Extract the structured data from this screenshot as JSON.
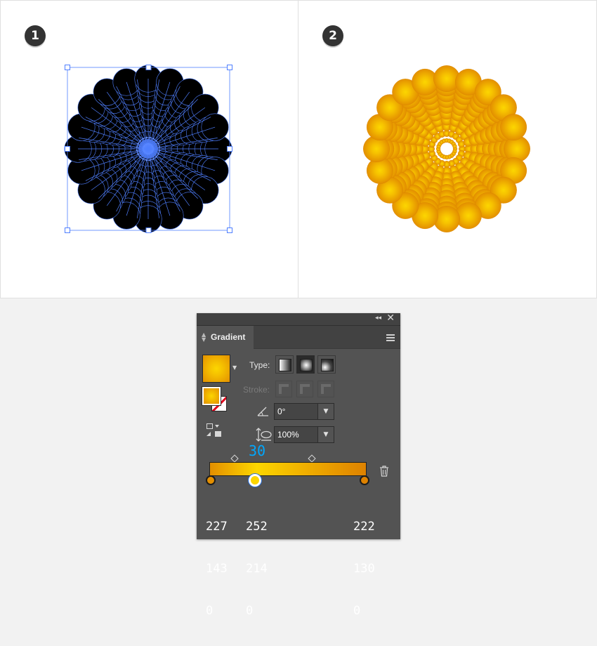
{
  "steps": [
    {
      "badge": "1"
    },
    {
      "badge": "2"
    }
  ],
  "panel": {
    "tab_label": "Gradient",
    "type_label": "Type:",
    "stroke_label": "Stroke:",
    "angle": "0°",
    "aspect_ratio": "100%",
    "location": "30",
    "stops": [
      {
        "color": "#e38f00",
        "rgb": [
          "227",
          "143",
          "0"
        ]
      },
      {
        "color": "#fcd600",
        "rgb": [
          "252",
          "214",
          "0"
        ],
        "selected": true
      },
      {
        "color": "#de8200",
        "rgb": [
          "222",
          "130",
          "0"
        ]
      }
    ]
  },
  "colors": {
    "selection_blue": "#4f7fff",
    "artwork_black": "#000000",
    "orange": "#e39000",
    "yellow": "#fcd600"
  }
}
